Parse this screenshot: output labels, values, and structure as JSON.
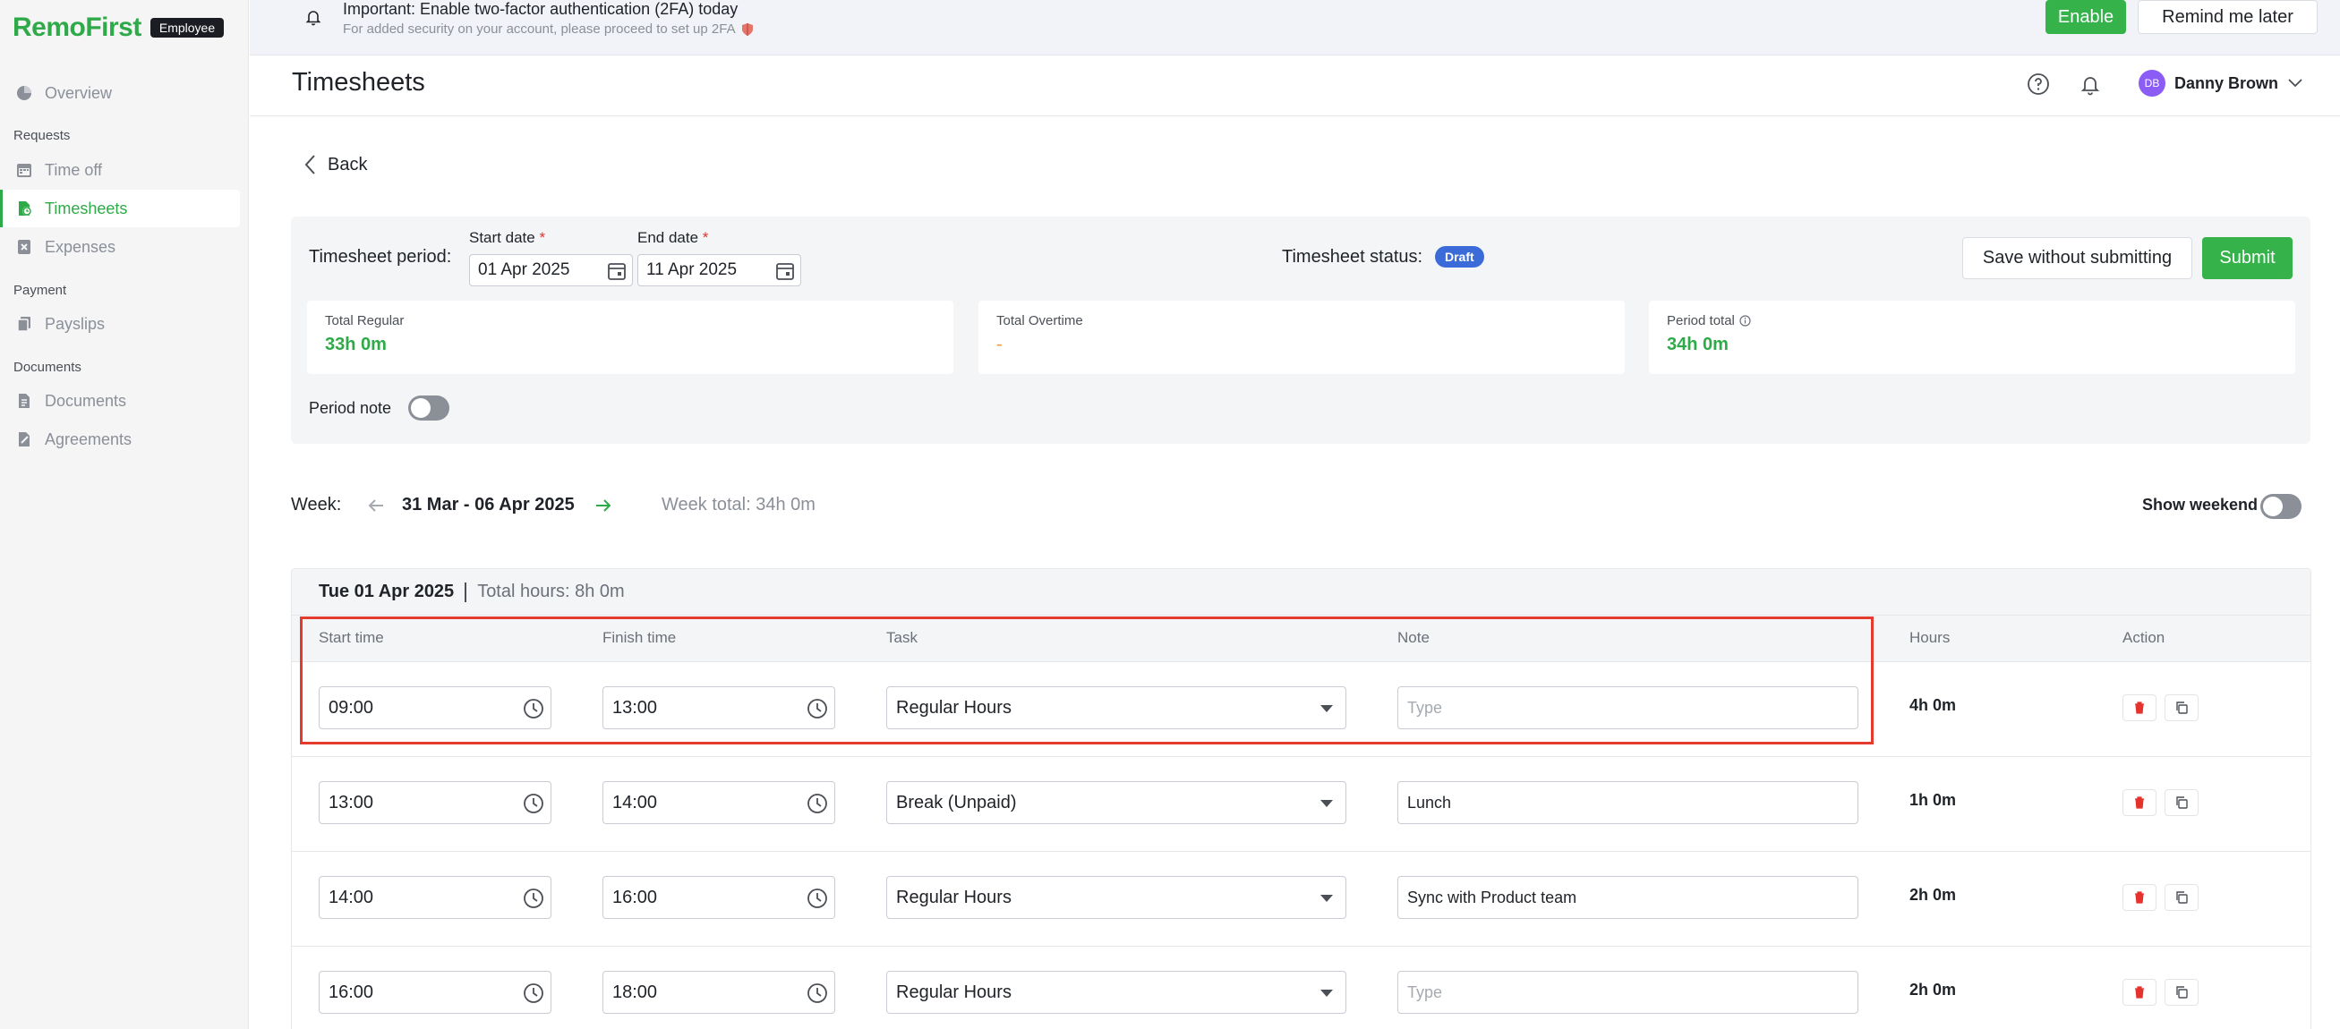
{
  "brand": {
    "name": "RemoFirst",
    "badge": "Employee",
    "color": "#2eaa48"
  },
  "sidebar": {
    "items": [
      {
        "label": "Overview",
        "icon": "pie-chart-icon"
      },
      {
        "section": "Requests"
      },
      {
        "label": "Time off",
        "icon": "calendar-icon"
      },
      {
        "label": "Timesheets",
        "icon": "timesheet-icon",
        "active": true
      },
      {
        "label": "Expenses",
        "icon": "receipt-icon"
      },
      {
        "section": "Payment"
      },
      {
        "label": "Payslips",
        "icon": "payslip-icon"
      },
      {
        "section": "Documents"
      },
      {
        "label": "Documents",
        "icon": "document-icon"
      },
      {
        "label": "Agreements",
        "icon": "agreement-icon"
      }
    ]
  },
  "banner": {
    "title": "Important: Enable two-factor authentication (2FA) today",
    "subtitle": "For added security on your account, please proceed to set up 2FA",
    "enable_label": "Enable",
    "remind_label": "Remind me later"
  },
  "header": {
    "title": "Timesheets",
    "user": {
      "initials": "DB",
      "name": "Danny Brown"
    }
  },
  "back_label": "Back",
  "period": {
    "label": "Timesheet period:",
    "start_label": "Start date",
    "start_value": "01 Apr 2025",
    "end_label": "End date",
    "end_value": "11 Apr 2025",
    "status_label": "Timesheet status:",
    "status": "Draft",
    "save_label": "Save without submitting",
    "submit_label": "Submit",
    "stats": [
      {
        "label": "Total Regular",
        "value": "33h 0m"
      },
      {
        "label": "Total Overtime",
        "value": "-"
      },
      {
        "label": "Period total",
        "value": "34h 0m"
      }
    ],
    "note_label": "Period note",
    "note_enabled": false
  },
  "week": {
    "label": "Week:",
    "range": "31 Mar - 06 Apr 2025",
    "total": "Week total: 34h 0m",
    "weekend_label": "Show weekend",
    "weekend_enabled": false
  },
  "day": {
    "date": "Tue 01 Apr 2025",
    "total": "Total hours: 8h 0m",
    "columns": [
      "Start time",
      "Finish time",
      "Task",
      "Note",
      "Hours",
      "Action"
    ],
    "rows": [
      {
        "start": "09:00",
        "finish": "13:00",
        "task": "Regular Hours",
        "note": "",
        "note_placeholder": "Type",
        "hours": "4h 0m"
      },
      {
        "start": "13:00",
        "finish": "14:00",
        "task": "Break (Unpaid)",
        "note": "Lunch",
        "note_placeholder": "Type",
        "hours": "1h 0m"
      },
      {
        "start": "14:00",
        "finish": "16:00",
        "task": "Regular Hours",
        "note": "Sync with Product team",
        "note_placeholder": "Type",
        "hours": "2h 0m"
      },
      {
        "start": "16:00",
        "finish": "18:00",
        "task": "Regular Hours",
        "note": "",
        "note_placeholder": "Type",
        "hours": "2h 0m"
      }
    ]
  }
}
